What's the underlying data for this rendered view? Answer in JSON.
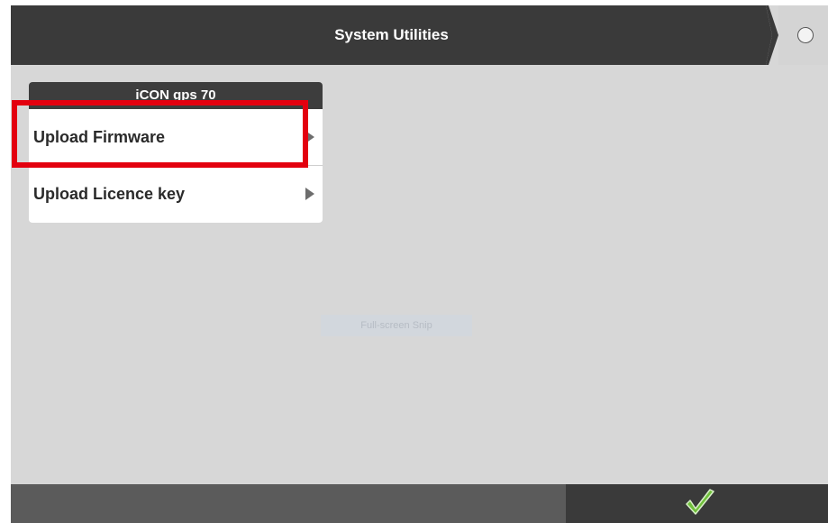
{
  "header": {
    "title": "System Utilities",
    "status_icon": "circle-status-icon"
  },
  "panel": {
    "title": "iCON gps 70",
    "items": [
      {
        "label": "Upload Firmware",
        "icon": "chevron-right-icon",
        "highlighted": true
      },
      {
        "label": "Upload Licence key",
        "icon": "chevron-right-icon",
        "highlighted": false
      }
    ]
  },
  "overlay": {
    "snip_label": "Full-screen Snip"
  },
  "footer": {
    "confirm_icon": "checkmark-icon",
    "confirm_color": "#6fbf3a"
  },
  "colors": {
    "header_bg": "#3a3a3a",
    "screen_bg": "#d7d7d7",
    "highlight": "#e3000f",
    "footer_left": "#5b5b5b",
    "footer_right": "#3a3a3a"
  }
}
